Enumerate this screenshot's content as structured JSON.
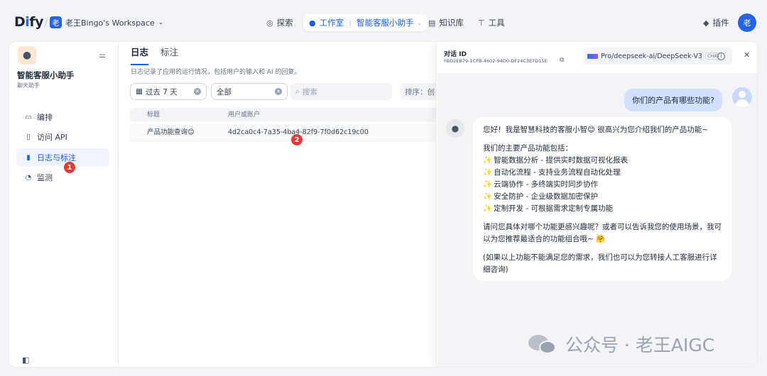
{
  "topbar": {
    "logo_prefix": "D",
    "logo_i": "i",
    "logo_suffix": "fy",
    "separator": "/",
    "workspace_badge": "老",
    "workspace_name": "老王Bingo's Workspace",
    "nav": {
      "explore": "探索",
      "studio": "工作室",
      "app_name": "智能客服小助手",
      "knowledge": "知识库",
      "tools": "工具",
      "plugins": "插件"
    },
    "avatar": "老"
  },
  "sidebar": {
    "app_name": "智能客服小助手",
    "app_type": "聊天助手",
    "items": [
      {
        "label": "编排",
        "icon": "orchestrate-icon"
      },
      {
        "label": "访问 API",
        "icon": "api-icon"
      },
      {
        "label": "日志与标注",
        "icon": "logs-icon",
        "active": true
      },
      {
        "label": "监测",
        "icon": "monitor-icon"
      }
    ]
  },
  "content": {
    "tabs": [
      "日志",
      "标注"
    ],
    "description": "日志记录了应用的运行情况，包括用户的输入和 AI 的回复。",
    "filters": {
      "period": "过去 7 天",
      "status": "全部",
      "search_placeholder": "搜索",
      "sort": "排序：创"
    },
    "table": {
      "headers": [
        "标题",
        "用户或账户"
      ],
      "rows": [
        {
          "title": "产品功能查询😊",
          "user": "4d2ca0c4-7a35-4ba4-82f9-7f0d62c19c00"
        }
      ]
    },
    "markers": [
      "1",
      "2"
    ]
  },
  "panel": {
    "id_label": "对话 ID",
    "conversation_id": "FBD2EB79-1CFB-4602-94D0-DF24C3E7D15E",
    "model": "Pro/deepseek-ai/DeepSeek-V3",
    "model_tag": "CHAT",
    "user_message": "你们的产品有哪些功能?",
    "bot": {
      "greeting": "您好！我是智慧科技的客服小智😊 很高兴为您介绍我们的产品功能~",
      "intro": "我们的主要产品功能包括：",
      "features": [
        "智能数据分析 - 提供实时数据可视化报表",
        "自动化流程 - 支持业务流程自动化处理",
        "云端协作 - 多终端实时同步协作",
        "安全防护 - 企业级数据加密保护",
        "定制开发 - 可根据需求定制专属功能"
      ],
      "question": "请问您具体对哪个功能更感兴趣呢？或者可以告诉我您的使用场景，我可以为您推荐最适合的功能组合哦~ 🤗",
      "note": "(如果以上功能不能满足您的需求，我们也可以为您转接人工客服进行详细咨询)"
    }
  },
  "watermark": "公众号 · 老王AIGC"
}
